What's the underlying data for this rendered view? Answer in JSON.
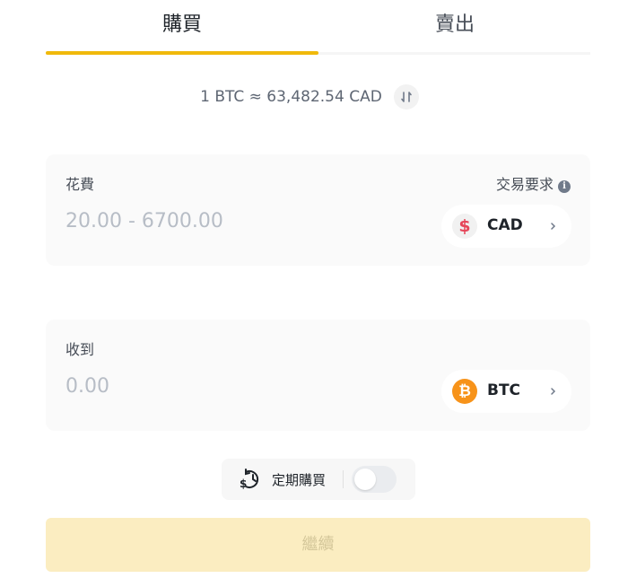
{
  "tabs": {
    "buy_label": "購買",
    "sell_label": "賣出",
    "active": "buy"
  },
  "rate": {
    "text": "1 BTC ≈ 63,482.54 CAD"
  },
  "spend": {
    "label": "花費",
    "requirements_label": "交易要求",
    "placeholder": "20.00 - 6700.00",
    "currency": {
      "code": "CAD",
      "icon": "dollar-sign-icon",
      "color": "#e6475a"
    }
  },
  "receive": {
    "label": "收到",
    "placeholder": "0.00",
    "currency": {
      "code": "BTC",
      "icon": "bitcoin-icon",
      "color": "#f7931a"
    }
  },
  "recurring": {
    "label": "定期購買",
    "enabled": false
  },
  "continue": {
    "label": "繼續"
  },
  "colors": {
    "accent": "#f0b90b",
    "button_disabled_bg": "#fbedc1"
  }
}
